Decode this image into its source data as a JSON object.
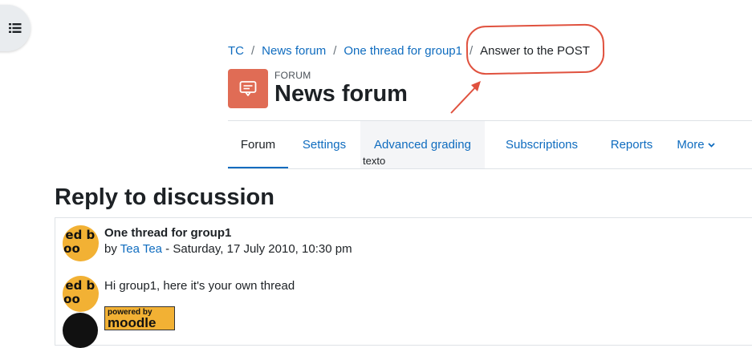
{
  "drawer": {
    "icon": "list-icon"
  },
  "breadcrumb": {
    "items": [
      "TC",
      "News forum",
      "One thread for group1"
    ],
    "separator": "/",
    "current": "Answer to the POST"
  },
  "annotation": {
    "color": "#e0523f"
  },
  "header": {
    "icon": "forum-icon",
    "activity_type": "FORUM",
    "title": "News forum"
  },
  "tabs": [
    {
      "label": "Forum",
      "active": true
    },
    {
      "label": "Settings"
    },
    {
      "label": "Advanced grading"
    },
    {
      "label": "Subscriptions"
    },
    {
      "label": "Reports"
    },
    {
      "label": "More"
    }
  ],
  "tooltip": "texto",
  "reply": {
    "heading": "Reply to discussion"
  },
  "post": {
    "subject": "One thread for group1",
    "by_prefix": "by",
    "author": "Tea Tea",
    "date_separator": " - ",
    "date": "Saturday, 17 July 2010, 10:30 pm",
    "message": "Hi group1, here it's your own thread",
    "badge_small": "powered by",
    "badge_large": "moodle"
  },
  "colors": {
    "link": "#0f6cbf",
    "forum_icon_bg": "#e06c55",
    "avatar_bg": "#f2b134"
  }
}
